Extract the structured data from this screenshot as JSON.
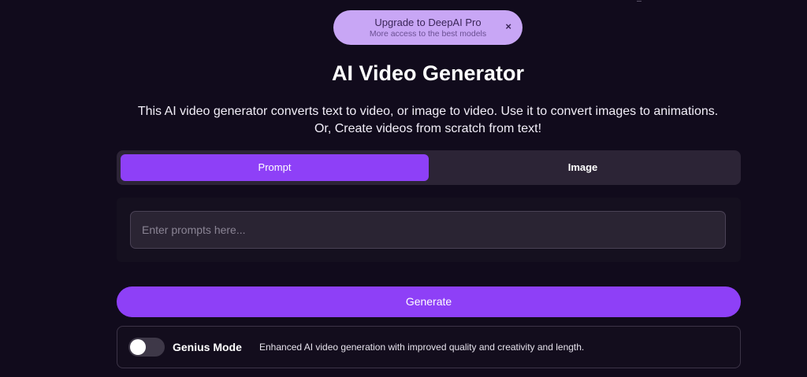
{
  "banner": {
    "title": "Upgrade to DeepAI Pro",
    "subtitle": "More access to the best models",
    "close_icon": "×"
  },
  "page": {
    "title": "AI Video Generator",
    "description": "This AI video generator converts text to video, or image to video. Use it to convert images to animations. Or, Create videos from scratch from text!"
  },
  "tabs": [
    {
      "label": "Prompt",
      "active": true
    },
    {
      "label": "Image",
      "active": false
    }
  ],
  "prompt": {
    "placeholder": "Enter prompts here...",
    "value": ""
  },
  "generate": {
    "label": "Generate"
  },
  "genius": {
    "label": "Genius Mode",
    "description": "Enhanced AI video generation with improved quality and creativity and length.",
    "enabled": false
  },
  "colors": {
    "background": "#110b1c",
    "accent": "#8e40f7",
    "banner": "#c8a6f5"
  }
}
